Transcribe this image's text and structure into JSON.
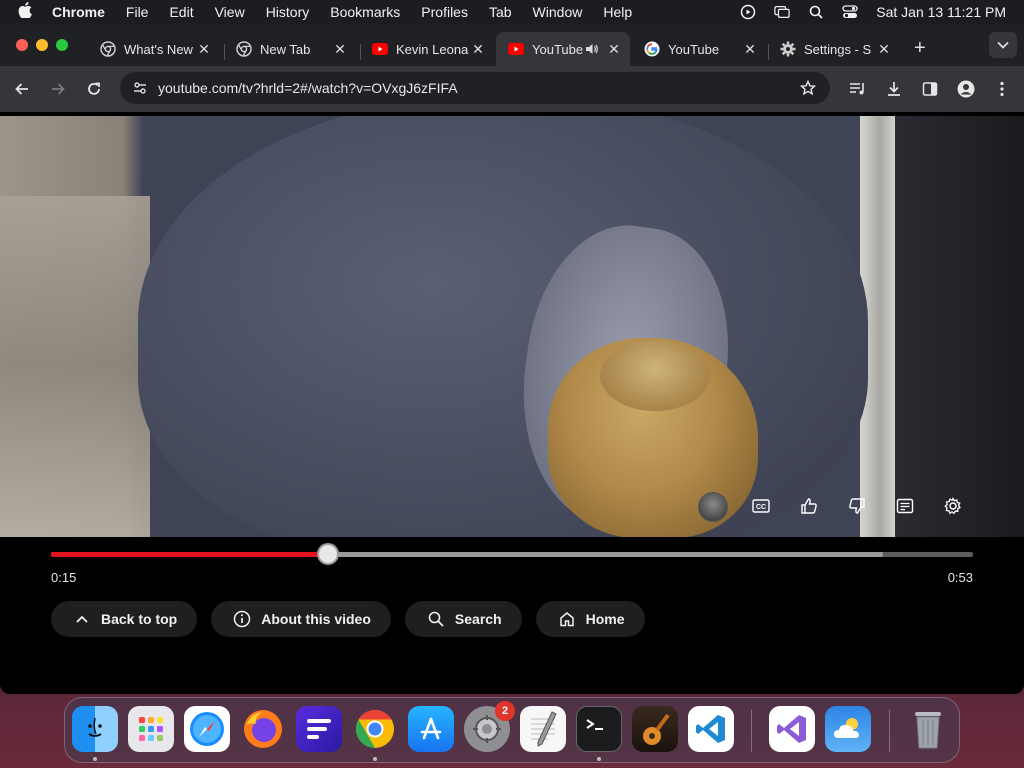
{
  "menubar": {
    "app_name": "Chrome",
    "items": [
      "File",
      "Edit",
      "View",
      "History",
      "Bookmarks",
      "Profiles",
      "Tab",
      "Window",
      "Help"
    ],
    "datetime": "Sat Jan 13  11:21 PM"
  },
  "tabs": [
    {
      "title": "What's New",
      "favicon": "chrome-icon",
      "active": false
    },
    {
      "title": "New Tab",
      "favicon": "chrome-icon",
      "active": false
    },
    {
      "title": "Kevin Leona",
      "favicon": "youtube-icon",
      "active": false
    },
    {
      "title": "YouTube",
      "favicon": "youtube-icon",
      "active": true,
      "audio": true
    },
    {
      "title": "YouTube",
      "favicon": "google-icon",
      "active": false
    },
    {
      "title": "Settings - S",
      "favicon": "gear-icon",
      "active": false
    }
  ],
  "toolbar": {
    "url": "youtube.com/tv?hrld=2#/watch?v=OVxgJ6zFIFA"
  },
  "player": {
    "current_time": "0:15",
    "duration": "0:53",
    "played_fraction": 0.3,
    "buffered_fraction": 0.902
  },
  "actions": {
    "back_to_top": "Back to top",
    "about": "About this video",
    "search": "Search",
    "home": "Home"
  },
  "dock": {
    "apps": [
      "Finder",
      "Launchpad",
      "Safari",
      "Firefox",
      "Fenix",
      "Chrome",
      "App Store",
      "System Settings",
      "TextEdit",
      "Terminal",
      "GarageBand",
      "VS Code",
      "Visual Studio",
      "Weather",
      "Trash"
    ],
    "system_settings_badge": "2"
  },
  "colors": {
    "progress_played": "#e1121b",
    "youtube_red": "#ff0000"
  }
}
